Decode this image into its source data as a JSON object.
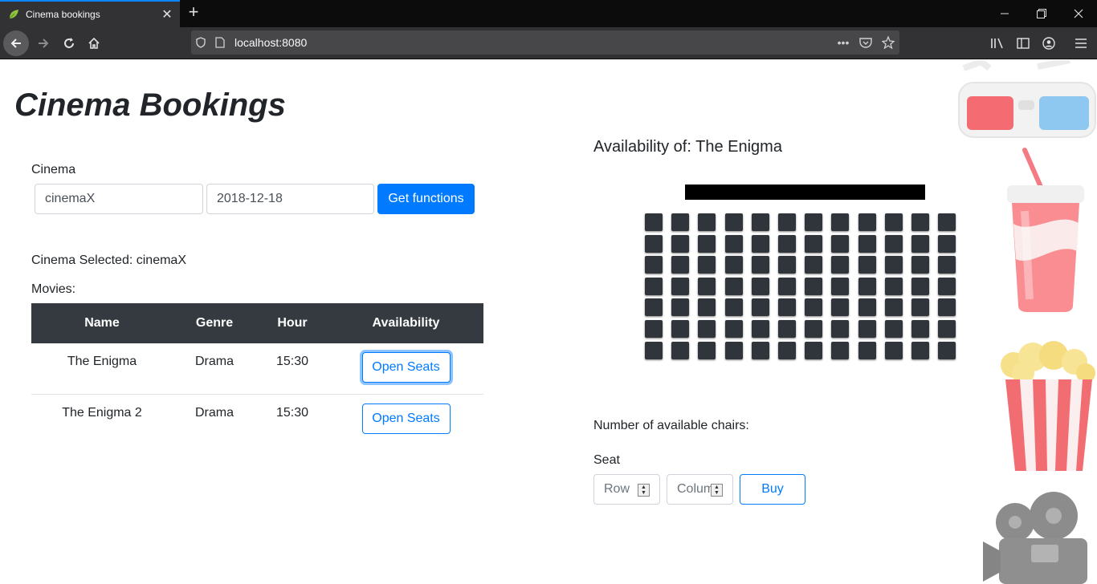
{
  "browser": {
    "tab_title": "Cinema bookings",
    "url": "localhost:8080"
  },
  "page": {
    "title": "Cinema Bookings",
    "cinema_label": "Cinema",
    "cinema_input": "cinemaX",
    "date_input": "2018-12-18",
    "get_functions_label": "Get functions",
    "cinema_selected_label": "Cinema Selected:",
    "cinema_selected_value": "cinemaX",
    "movies_label": "Movies:",
    "table": {
      "headers": [
        "Name",
        "Genre",
        "Hour",
        "Availability"
      ],
      "rows": [
        {
          "name": "The Enigma",
          "genre": "Drama",
          "hour": "15:30",
          "action": "Open Seats"
        },
        {
          "name": "The Enigma 2",
          "genre": "Drama",
          "hour": "15:30",
          "action": "Open Seats"
        }
      ]
    },
    "availability_label": "Availability of:",
    "availability_movie": "The Enigma",
    "seat_grid": {
      "rows": 7,
      "cols": 12
    },
    "available_chairs_label": "Number of available chairs:",
    "seat_label": "Seat",
    "row_placeholder": "Row",
    "column_placeholder": "Column",
    "buy_label": "Buy"
  },
  "colors": {
    "primary": "#007bff",
    "table_header": "#343a40",
    "seat": "#2f353b"
  }
}
